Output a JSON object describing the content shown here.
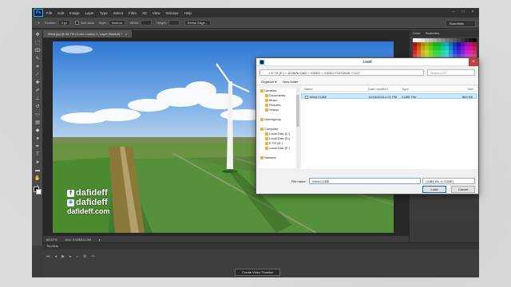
{
  "app": {
    "logo": "Ps"
  },
  "menu": [
    "File",
    "Edit",
    "Image",
    "Layer",
    "Type",
    "Select",
    "Filter",
    "3D",
    "View",
    "Window",
    "Help"
  ],
  "options": {
    "feather_label": "Feather:",
    "feather_value": "0 px",
    "antialias": "Anti-alias",
    "style_label": "Style:",
    "style_value": "Normal",
    "width_label": "Width:",
    "height_label": "Height:",
    "refine": "Refine Edge...",
    "workspace": "Essentials"
  },
  "document": {
    "tab_title": "Wind.jpg @ 66.7% (Color Lookup 1, Layer Mask/8) *",
    "zoom": "66.67%",
    "doc_size": "Doc: 5.93M/11.9M"
  },
  "watermark": {
    "line1": "dafideff",
    "line2": "dafideff",
    "line3": "dafideff.com"
  },
  "timeline": {
    "title": "Timeline",
    "create_button": "Create Video Timeline"
  },
  "panels": {
    "tab_color": "Color",
    "tab_swatches": "Swatches"
  },
  "dialog": {
    "title": "Load",
    "path": "> E:TR (E:) > DOWNLOAD > VIDEO > VIDEO FOOTAGE > LUT",
    "search_placeholder": "Search LUT",
    "organize": "Organize ▾",
    "new_folder": "New folder",
    "nav": [
      {
        "label": "Libraries",
        "sub": false
      },
      {
        "label": "Documents",
        "sub": true
      },
      {
        "label": "Music",
        "sub": true
      },
      {
        "label": "Pictures",
        "sub": true
      },
      {
        "label": "Videos",
        "sub": true
      },
      {
        "label": "",
        "sub": false
      },
      {
        "label": "Homegroup",
        "sub": false
      },
      {
        "label": "",
        "sub": false
      },
      {
        "label": "Computer",
        "sub": false
      },
      {
        "label": "Local Disk (C:)",
        "sub": true
      },
      {
        "label": "Local Disk (D:)",
        "sub": true
      },
      {
        "label": "E:TR (E:)",
        "sub": true
      },
      {
        "label": "Local Disk (F:)",
        "sub": true
      },
      {
        "label": "",
        "sub": false
      },
      {
        "label": "Network",
        "sub": false
      }
    ],
    "columns": [
      "Name",
      "Date modified",
      "Type",
      "Size"
    ],
    "files": [
      {
        "name": "Wind.CUBE",
        "date": "11/16/2016 2:21 PM",
        "type": "CUBE File",
        "size": "863 KB"
      }
    ],
    "filename_label": "File name:",
    "filename_value": "Wind.CUBE",
    "filetype": "CUBE file (*.CUBE)",
    "load_button": "Load",
    "cancel_button": "Cancel"
  }
}
